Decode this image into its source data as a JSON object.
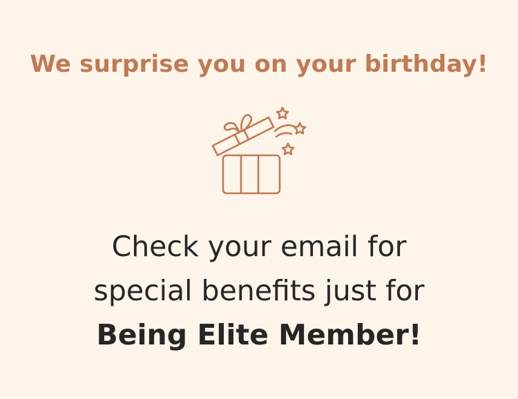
{
  "headline": "We surprise you on your birthday!",
  "message": {
    "line1": "Check your email for",
    "line2": "special benefits just for",
    "line3": "Being Elite Member!"
  },
  "colors": {
    "background": "#fdf4ea",
    "accent": "#c07a54",
    "text": "#262626"
  },
  "icon": "gift-box-icon"
}
